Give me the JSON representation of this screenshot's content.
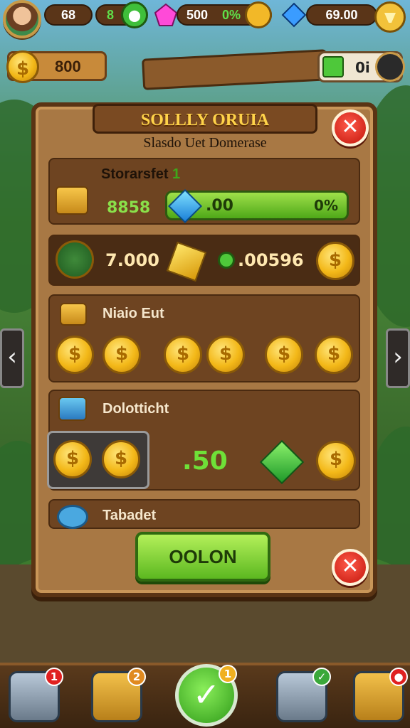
{
  "hud": {
    "val_a": "68",
    "val_b": "8",
    "val_c": "500",
    "val_d": "0%",
    "val_e": "69.00"
  },
  "secondary": {
    "coins": "800",
    "right_val": "0i"
  },
  "panel": {
    "title": "SOLLLY ORUIA",
    "subtitle": "Slasdo Uet Domerase",
    "section1": {
      "label": "Storarsfet",
      "label_num": "1",
      "amount": "8858",
      "bar_text": ".00",
      "bar_pct": "0%"
    },
    "section2": {
      "value_a": "7.000",
      "value_b": ".00596"
    },
    "section3": {
      "label": "Niaio Eut"
    },
    "section4": {
      "label": "Dolotticht",
      "value": ".50"
    },
    "section5": {
      "label": "Tabadet"
    },
    "ok_label": "OOLON"
  },
  "bottom_bar": {
    "badge1": "1",
    "badge2": "2",
    "badge_center": "1",
    "badge4": "",
    "badge5": ""
  },
  "colors": {
    "accent_green": "#5cb820",
    "close_red": "#c2150b",
    "panel_wood": "#a87844",
    "title_gold": "#ffd34a"
  }
}
